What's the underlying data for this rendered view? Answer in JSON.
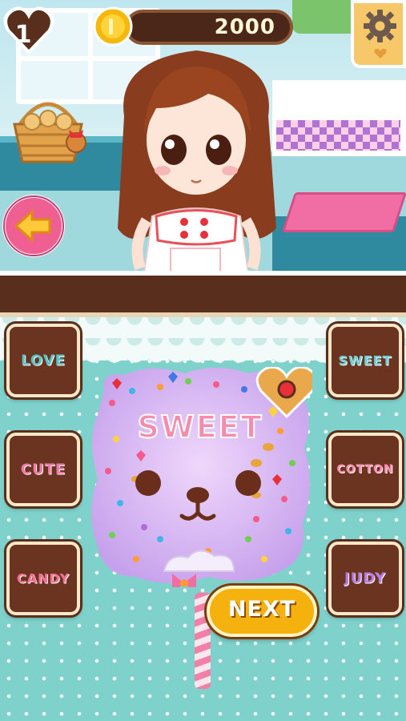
{
  "hud": {
    "lives": "1",
    "coins": "2000",
    "settings_icon": "gear-icon",
    "back_icon": "arrow-left-icon"
  },
  "word_buttons": {
    "left": [
      "LOVE",
      "CUTE",
      "CANDY"
    ],
    "right": [
      "SWEET",
      "COTTON",
      "JUDY"
    ]
  },
  "candy": {
    "topping_text": "SWEET"
  },
  "next_label": "NEXT",
  "colors": {
    "accent": "#f5b10e",
    "brown": "#5a2e1c",
    "pink": "#e84c8a",
    "teal_bg": "#7fd1cb"
  }
}
